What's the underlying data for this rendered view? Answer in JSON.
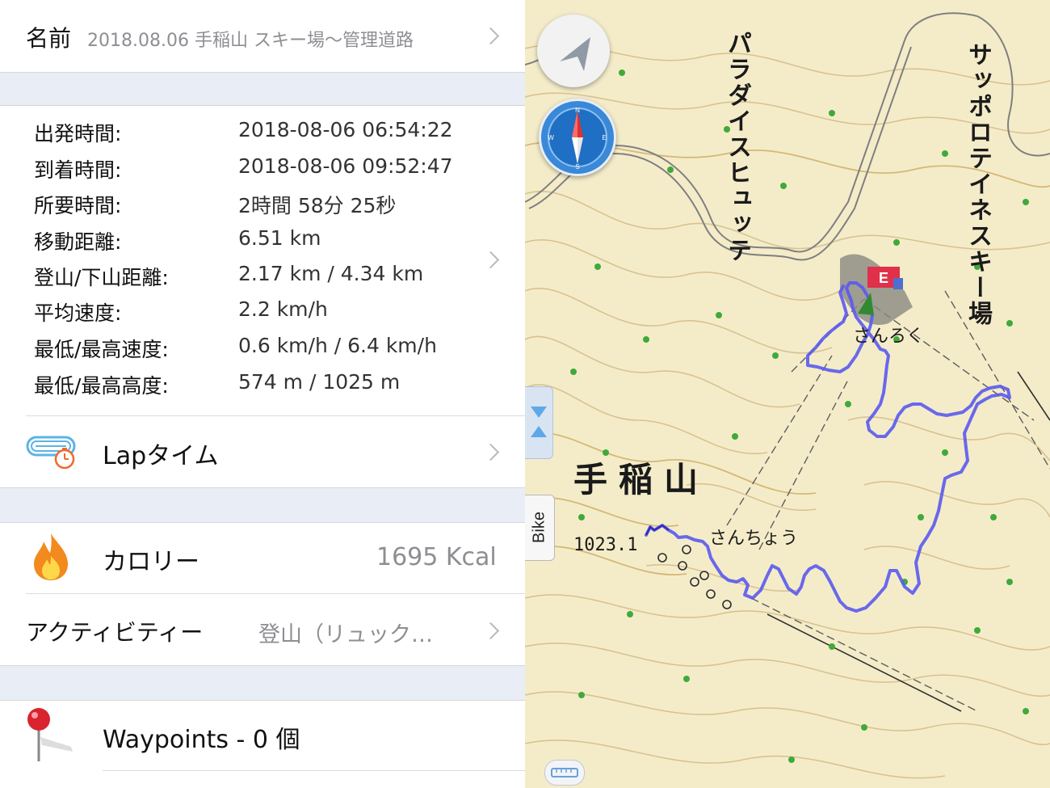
{
  "name_row": {
    "label": "名前",
    "value": "2018.08.06 手稲山 スキー場〜管理道路"
  },
  "stats": [
    {
      "label": "出発時間:",
      "value": "2018-08-06 06:54:22"
    },
    {
      "label": "到着時間:",
      "value": "2018-08-06 09:52:47"
    },
    {
      "label": "所要時間:",
      "value": "2時間 58分 25秒"
    },
    {
      "label": "移動距離:",
      "value": "6.51 km"
    },
    {
      "label": "登山/下山距離:",
      "value": "2.17 km / 4.34 km"
    },
    {
      "label": "平均速度:",
      "value": "2.2 km/h"
    },
    {
      "label": "最低/最高速度:",
      "value": "0.6 km/h / 6.4 km/h"
    },
    {
      "label": "最低/最高高度:",
      "value": "574 m / 1025 m"
    }
  ],
  "lap": {
    "label": "Lapタイム"
  },
  "calorie": {
    "label": "カロリー",
    "value": "1695 Kcal"
  },
  "activity": {
    "label": "アクティビティー",
    "value": "登山（リュック…"
  },
  "waypoints": {
    "label": "Waypoints - 0 個"
  },
  "map": {
    "labels": {
      "paradise_hut": "パラダイスヒュッテ",
      "sapporo_teine": "サッポロテイネスキー場",
      "sanroku": "さんろく",
      "mt_teine": "手稲山",
      "sancho": "さんちょう",
      "elevation": "1023.1",
      "end_flag": "E"
    },
    "bike_tab": "Bike",
    "compass_letters": {
      "n": "N",
      "e": "E",
      "s": "S",
      "w": "W"
    }
  },
  "colors": {
    "track": "#5a5af0",
    "map_bg": "#f4ecc9",
    "band": "#e9eef6",
    "end_flag": "#e0304a"
  }
}
